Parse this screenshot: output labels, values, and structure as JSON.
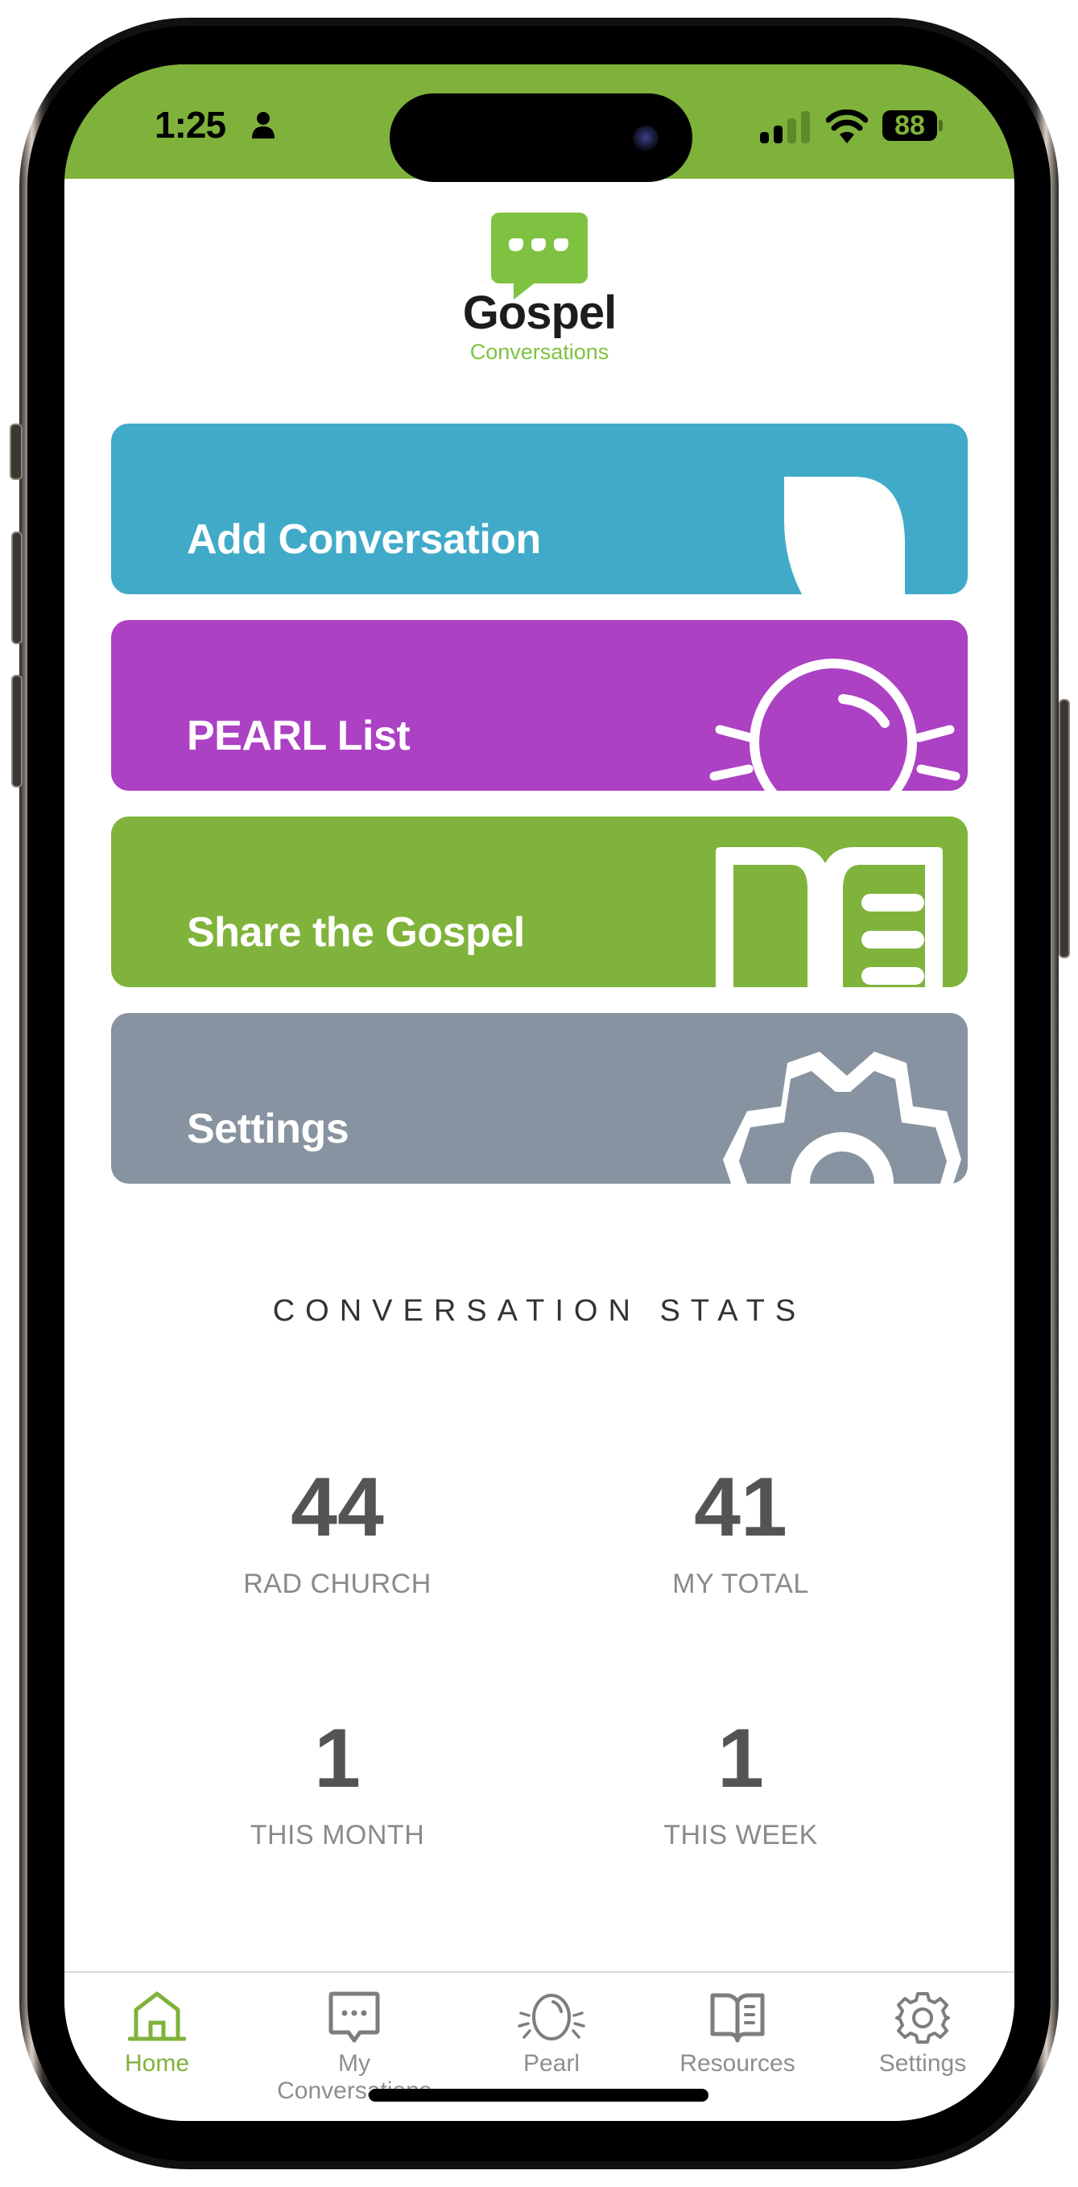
{
  "status_bar": {
    "time": "1:25",
    "battery_percent": "88",
    "signal_bars_active": 2,
    "signal_bars_total": 4,
    "icons": [
      "person-icon",
      "signal-icon",
      "wifi-icon",
      "battery-icon"
    ]
  },
  "logo": {
    "title": "Gospel",
    "subtitle": "Conversations",
    "icon": "chat-bubble-icon"
  },
  "colors": {
    "brand_green": "#7fb23a",
    "add_card": "#41aac8",
    "pearl_card": "#ac41c4",
    "share_card": "#80b33b",
    "settings_card": "#8793a0",
    "stat_value": "#545454",
    "stat_label": "#8a8a8a",
    "tab_inactive": "#8e8e8e"
  },
  "cards": [
    {
      "label": "Add Conversation",
      "icon": "chat-bubble-icon"
    },
    {
      "label": "PEARL List",
      "icon": "pearl-icon"
    },
    {
      "label": "Share the Gospel",
      "icon": "book-icon"
    },
    {
      "label": "Settings",
      "icon": "gear-icon"
    }
  ],
  "stats": {
    "title": "CONVERSATION STATS",
    "items": [
      {
        "value": "44",
        "label": "RAD CHURCH"
      },
      {
        "value": "41",
        "label": "MY TOTAL"
      },
      {
        "value": "1",
        "label": "THIS MONTH"
      },
      {
        "value": "1",
        "label": "THIS WEEK"
      }
    ]
  },
  "tabbar": {
    "active": "Home",
    "tabs": [
      {
        "label": "Home",
        "icon": "home-icon"
      },
      {
        "label": "My Conversations",
        "icon": "chat-bubble-icon"
      },
      {
        "label": "Pearl",
        "icon": "pearl-icon"
      },
      {
        "label": "Resources",
        "icon": "book-icon"
      },
      {
        "label": "Settings",
        "icon": "gear-icon"
      }
    ]
  }
}
